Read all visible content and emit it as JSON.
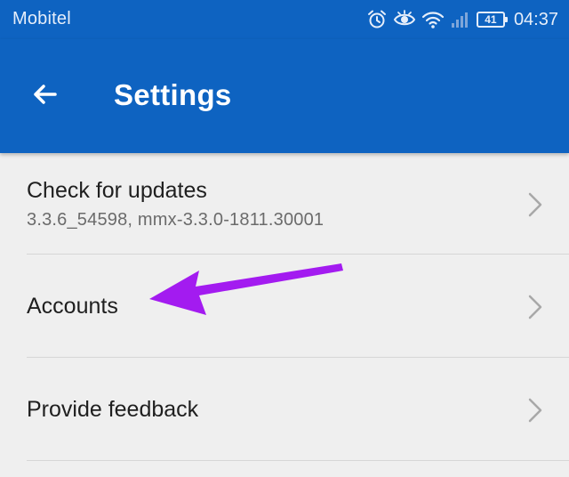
{
  "status_bar": {
    "carrier": "Mobitel",
    "battery": "41",
    "time": "04:37",
    "icons": [
      "alarm-icon",
      "eye-icon",
      "wifi-icon",
      "signal-icon",
      "battery-icon"
    ]
  },
  "app_bar": {
    "back_icon": "arrow-left-icon",
    "title": "Settings",
    "color": "#0e63c1"
  },
  "settings": {
    "items": [
      {
        "title": "Check for updates",
        "subtitle": "3.3.6_54598, mmx-3.3.0-1811.30001",
        "icon": "chevron-right-icon"
      },
      {
        "title": "Accounts",
        "icon": "chevron-right-icon"
      },
      {
        "title": "Provide feedback",
        "icon": "chevron-right-icon"
      }
    ]
  },
  "annotation": {
    "arrow_color": "#a31bf0",
    "icon": "pointer-arrow-icon"
  }
}
